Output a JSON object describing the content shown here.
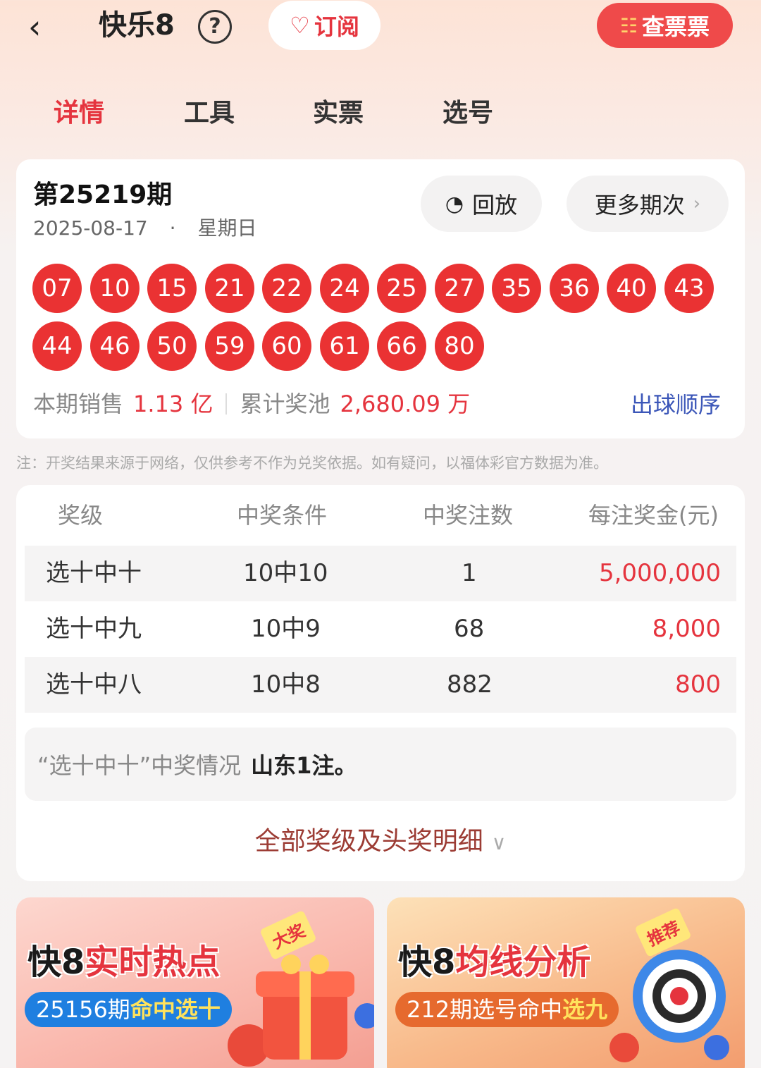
{
  "header": {
    "back_icon": "chevron-left-icon",
    "title": "快乐8",
    "help_label": "?",
    "subscribe_label": "订阅",
    "check_ticket_label": "查票票"
  },
  "tabs": [
    {
      "label": "详情",
      "active": true
    },
    {
      "label": "工具",
      "active": false
    },
    {
      "label": "实票",
      "active": false
    },
    {
      "label": "选号",
      "active": false
    }
  ],
  "draw": {
    "period": "第25219期",
    "date": "2025-08-17",
    "dot": "·",
    "weekday": "星期日",
    "replay_label": "回放",
    "more_periods_label": "更多期次",
    "numbers_row1": [
      "07",
      "10",
      "15",
      "21",
      "22",
      "24",
      "25",
      "27",
      "35",
      "36",
      "40",
      "43"
    ],
    "numbers_row2": [
      "44",
      "46",
      "50",
      "59",
      "60",
      "61",
      "66",
      "80"
    ],
    "sales_label": "本期销售",
    "sales_value": "1.13 亿",
    "pool_label": "累计奖池",
    "pool_value": "2,680.09 万",
    "order_link": "出球顺序"
  },
  "note": "注：开奖结果来源于网络，仅供参考不作为兑奖依据。如有疑问，以福体彩官方数据为准。",
  "prize_table": {
    "headers": [
      "奖级",
      "中奖条件",
      "中奖注数",
      "每注奖金(元)"
    ],
    "rows": [
      {
        "level": "选十中十",
        "condition": "10中10",
        "count": "1",
        "prize": "5,000,000"
      },
      {
        "level": "选十中九",
        "condition": "10中9",
        "count": "68",
        "prize": "8,000"
      },
      {
        "level": "选十中八",
        "condition": "10中8",
        "count": "882",
        "prize": "800"
      }
    ]
  },
  "winner_info": {
    "label": "“选十中十”中奖情况",
    "value": "山东1注。"
  },
  "all_prizes_label": "全部奖级及头奖明细",
  "banners": [
    {
      "title_a": "快8",
      "title_b": "实时热点",
      "subtitle_a": "25156期",
      "subtitle_b": "命中选十",
      "badge": "大奖"
    },
    {
      "title_a": "快8",
      "title_b": "均线分析",
      "subtitle_a": "212期选号命中",
      "subtitle_b": "选九",
      "badge": "推荐"
    }
  ],
  "colors": {
    "accent_red": "#e5343e",
    "ball_red": "#ea3233",
    "link_blue": "#3b56b8"
  }
}
